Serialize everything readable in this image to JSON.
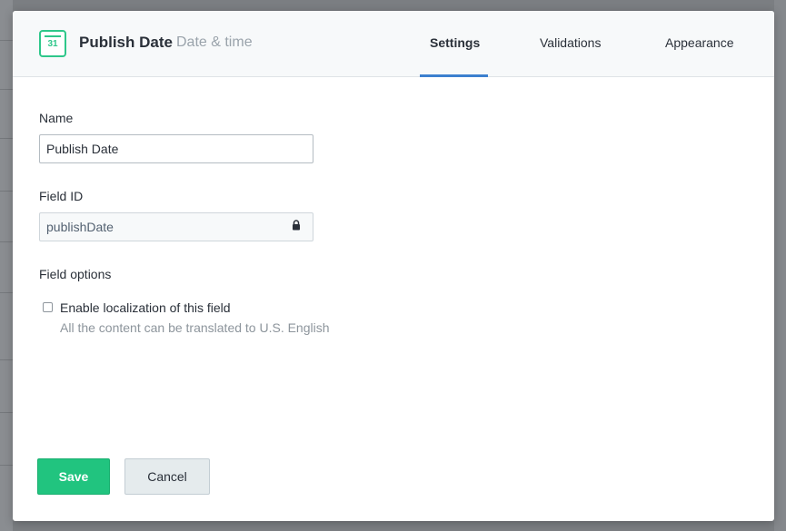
{
  "field": {
    "name": "Publish Date",
    "type": "Date & time",
    "icon": "calendar-icon",
    "icon_number": "31",
    "accent": "#2ec78a"
  },
  "tabs": [
    {
      "label": "Settings",
      "active": true
    },
    {
      "label": "Validations",
      "active": false
    },
    {
      "label": "Appearance",
      "active": false
    }
  ],
  "form": {
    "name_label": "Name",
    "name_value": "Publish Date",
    "field_id_label": "Field ID",
    "field_id_value": "publishDate",
    "field_options_label": "Field options",
    "localization_label": "Enable localization of this field",
    "localization_help": "All the content can be translated to U.S. English",
    "localization_checked": false
  },
  "actions": {
    "save_label": "Save",
    "cancel_label": "Cancel"
  },
  "colors": {
    "primary": "#21c47f",
    "tab_active": "#3c80cf"
  }
}
